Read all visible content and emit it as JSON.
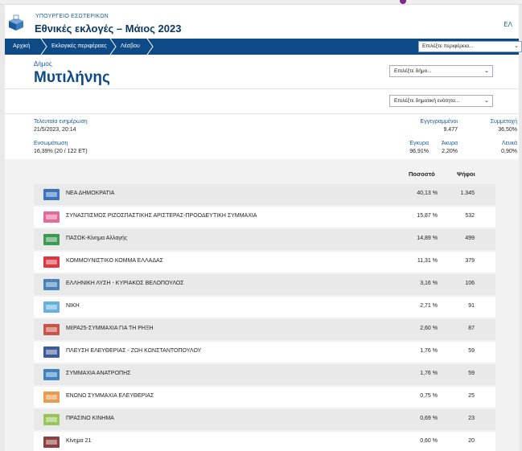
{
  "header": {
    "ministry": "ΥΠΟΥΡΓΕΙΟ ΕΣΩΤΕΡΙΚΩΝ",
    "title": "Εθνικές εκλογές – Μάιος 2023",
    "lang": "ΕΛ"
  },
  "breadcrumbs": [
    "Αρχική",
    "Εκλογικές περιφέρειες",
    "Λέσβου"
  ],
  "nav_select": "Επιλέξτε περιφέρεια...",
  "municipality": {
    "label": "Δήμος",
    "name": "Μυτιλήνης",
    "select_municipality": "Επιλέξτε δήμο...",
    "select_unit": "Επιλέξτε δημοτική ενότητα..."
  },
  "info": {
    "last_update_label": "Τελευταία ενημέρωση",
    "last_update_value": "21/5/2023, 20:14",
    "integration_label": "Ενσωμάτωση",
    "integration_value": "16,39% (20 / 122 ΕΤ)",
    "registered_label": "Εγγεγραμμένοι",
    "registered_value": "9.477",
    "turnout_label": "Συμμετοχή",
    "turnout_value": "36,50%",
    "valid_label": "Έγκυρα",
    "valid_value": "96,91%",
    "invalid_label": "Άκυρα",
    "invalid_value": "2,20%",
    "blank_label": "Λευκά",
    "blank_value": "0,90%"
  },
  "table": {
    "col_percent": "Ποσοστό",
    "col_votes": "Ψήφοι",
    "rows": [
      {
        "party": "ΝΕΑ ΔΗΜΟΚΡΑΤΙΑ",
        "percent": "40,13 %",
        "votes": "1.345",
        "icon": "nd-logo-icon",
        "color": "#1d5cb4"
      },
      {
        "party": "ΣΥΝΑΣΠΙΣΜΟΣ ΡΙΖΟΣΠΑΣΤΙΚΗΣ ΑΡΙΣΤΕΡΑΣ-ΠΡΟΟΔΕΥΤΙΚΗ ΣΥΜΜΑΧΙΑ",
        "percent": "15,87 %",
        "votes": "532",
        "icon": "syriza-logo-icon",
        "color": "#e0508a"
      },
      {
        "party": "ΠΑΣΟΚ-Κίνημα Αλλαγής",
        "percent": "14,89 %",
        "votes": "499",
        "icon": "pasok-logo-icon",
        "color": "#1e8a3a"
      },
      {
        "party": "ΚΟΜΜΟΥΝΙΣΤΙΚΟ ΚΟΜΜΑ ΕΛΛΑΔΑΣ",
        "percent": "11,31 %",
        "votes": "379",
        "icon": "kke-logo-icon",
        "color": "#d4141c"
      },
      {
        "party": "ΕΛΛΗΝΙΚΗ ΛΥΣΗ - ΚΥΡΙΑΚΟΣ ΒΕΛΟΠΟΥΛΟΣ",
        "percent": "3,16 %",
        "votes": "106",
        "icon": "elliniki-lysi-logo-icon",
        "color": "#2a6fb0"
      },
      {
        "party": "ΝΙΚΗ",
        "percent": "2,71 %",
        "votes": "91",
        "icon": "niki-logo-icon",
        "color": "#4aa3d8"
      },
      {
        "party": "ΜέΡΑ25-ΣΥΜΜΑΧΙΑ ΓΙΑ ΤΗ ΡΗΞΗ",
        "percent": "2,60 %",
        "votes": "87",
        "icon": "mera25-logo-icon",
        "color": "#c0392b"
      },
      {
        "party": "ΠΛΕΥΣΗ ΕΛΕΥΘΕΡΙΑΣ - ΖΩΗ ΚΩΝΣΤΑΝΤΟΠΟΥΛΟΥ",
        "percent": "1,76 %",
        "votes": "59",
        "icon": "plefsi-logo-icon",
        "color": "#1c3f8a"
      },
      {
        "party": "ΣΥΜΜΑΧΙΑ ΑΝΑΤΡΟΠΗΣ",
        "percent": "1,76 %",
        "votes": "59",
        "icon": "anatropi-logo-icon",
        "color": "#1f6fb8"
      },
      {
        "party": "ΕΝΩΝΩ ΣΥΜΜΑΧΙΑ ΕΛΕΥΘΕΡΙΑΣ",
        "percent": "0,75 %",
        "votes": "25",
        "icon": "enono-logo-icon",
        "color": "#e88a2e"
      },
      {
        "party": "ΠΡΑΣΙΝΟ ΚΙΝΗΜΑ",
        "percent": "0,69 %",
        "votes": "23",
        "icon": "prasino-logo-icon",
        "color": "#8cbf3f"
      },
      {
        "party": "Κίνημα 21",
        "percent": "0,60 %",
        "votes": "20",
        "icon": "kinima21-logo-icon",
        "color": "#7a1d1d"
      }
    ]
  }
}
